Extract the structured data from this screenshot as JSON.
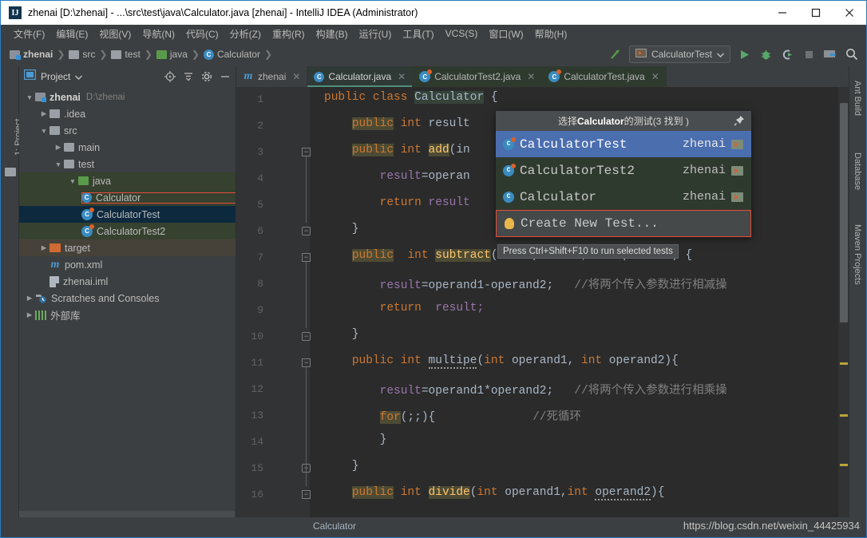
{
  "window": {
    "title": "zhenai [D:\\zhenai] - ...\\src\\test\\java\\Calculator.java [zhenai] - IntelliJ IDEA (Administrator)",
    "app_icon": "IJ",
    "minimize_label": "Minimize",
    "maximize_label": "Maximize",
    "close_label": "Close"
  },
  "menubar": {
    "items": [
      {
        "label": "文件(F)"
      },
      {
        "label": "编辑(E)"
      },
      {
        "label": "视图(V)"
      },
      {
        "label": "导航(N)"
      },
      {
        "label": "代码(C)"
      },
      {
        "label": "分析(Z)"
      },
      {
        "label": "重构(R)"
      },
      {
        "label": "构建(B)"
      },
      {
        "label": "运行(U)"
      },
      {
        "label": "工具(T)"
      },
      {
        "label": "VCS(S)"
      },
      {
        "label": "窗口(W)"
      },
      {
        "label": "帮助(H)"
      }
    ]
  },
  "navbar": {
    "breadcrumbs": [
      {
        "label": "zhenai",
        "icon": "module-icon"
      },
      {
        "label": "src",
        "icon": "folder-icon"
      },
      {
        "label": "test",
        "icon": "folder-icon"
      },
      {
        "label": "java",
        "icon": "source-folder-icon"
      },
      {
        "label": "Calculator",
        "icon": "class-icon"
      }
    ],
    "run_configuration": "CalculatorTest",
    "buttons": [
      {
        "name": "make-project-button",
        "icon": "hammer-arrow-icon"
      },
      {
        "name": "run-button",
        "icon": "play-icon"
      },
      {
        "name": "debug-button",
        "icon": "bug-icon"
      },
      {
        "name": "run-with-coverage-button",
        "icon": "coverage-icon"
      },
      {
        "name": "stop-button",
        "icon": "stop-icon"
      },
      {
        "name": "project-structure-button",
        "icon": "project-structure-icon"
      },
      {
        "name": "search-everywhere-button",
        "icon": "search-icon"
      }
    ]
  },
  "left_tool_strip": {
    "items": [
      {
        "label": "1: Project",
        "name": "tool-window-project"
      }
    ]
  },
  "right_tool_strip": {
    "items": [
      {
        "label": "Ant Build",
        "name": "tool-window-ant-build"
      },
      {
        "label": "Database",
        "name": "tool-window-database"
      },
      {
        "label": "Maven Projects",
        "name": "tool-window-maven-projects"
      }
    ]
  },
  "project_panel": {
    "title": "Project",
    "header_icons": [
      {
        "name": "locate-icon"
      },
      {
        "name": "collapse-all-icon"
      },
      {
        "name": "settings-gear-icon"
      },
      {
        "name": "hide-icon"
      }
    ],
    "tree": [
      {
        "label": "zhenai",
        "path": "D:\\zhenai",
        "depth": 0,
        "arrow": "▼",
        "icon": "module-icon",
        "bold": true,
        "state": "none"
      },
      {
        "label": ".idea",
        "path": "",
        "depth": 1,
        "arrow": "▶",
        "icon": "folder-icon",
        "bold": false,
        "state": "none"
      },
      {
        "label": "src",
        "path": "",
        "depth": 1,
        "arrow": "▼",
        "icon": "folder-icon",
        "bold": false,
        "state": "none"
      },
      {
        "label": "main",
        "path": "",
        "depth": 2,
        "arrow": "▶",
        "icon": "folder-icon",
        "bold": false,
        "state": "none"
      },
      {
        "label": "test",
        "path": "",
        "depth": 2,
        "arrow": "▼",
        "icon": "folder-icon",
        "bold": false,
        "state": "none"
      },
      {
        "label": "java",
        "path": "",
        "depth": 3,
        "arrow": "▼",
        "icon": "source-folder-icon",
        "bold": false,
        "state": "srcgreen"
      },
      {
        "label": "Calculator",
        "path": "",
        "depth": 4,
        "arrow": "",
        "icon": "class-icon",
        "bold": false,
        "state": "srcgreen-outlined"
      },
      {
        "label": "CalculatorTest",
        "path": "",
        "depth": 4,
        "arrow": "",
        "icon": "test-class-icon",
        "bold": false,
        "state": "selected"
      },
      {
        "label": "CalculatorTest2",
        "path": "",
        "depth": 4,
        "arrow": "",
        "icon": "test-class-icon",
        "bold": false,
        "state": "srcgreen"
      },
      {
        "label": "target",
        "path": "",
        "depth": 1,
        "arrow": "▶",
        "icon": "target-folder-icon",
        "bold": false,
        "state": "tan"
      },
      {
        "label": "pom.xml",
        "path": "",
        "depth": 1,
        "arrow": "",
        "icon": "maven-icon",
        "bold": false,
        "state": "none"
      },
      {
        "label": "zhenai.iml",
        "path": "",
        "depth": 1,
        "arrow": "",
        "icon": "iml-icon",
        "bold": false,
        "state": "none"
      },
      {
        "label": "Scratches and Consoles",
        "path": "",
        "depth": 0,
        "arrow": "▶",
        "icon": "scratches-icon",
        "bold": false,
        "state": "none"
      },
      {
        "label": "外部库",
        "path": "",
        "depth": 0,
        "arrow": "▶",
        "icon": "library-icon",
        "bold": false,
        "state": "none"
      }
    ]
  },
  "editor": {
    "tabs": [
      {
        "label": "zhenai",
        "icon": "maven-icon",
        "active": false,
        "highlight": "none"
      },
      {
        "label": "Calculator.java",
        "icon": "class-icon",
        "active": true,
        "highlight": "active"
      },
      {
        "label": "CalculatorTest2.java",
        "icon": "test-class-icon",
        "active": false,
        "highlight": "green"
      },
      {
        "label": "CalculatorTest.java",
        "icon": "test-class-icon",
        "active": false,
        "highlight": "green"
      }
    ],
    "line_numbers": [
      1,
      2,
      3,
      4,
      5,
      6,
      7,
      8,
      9,
      10,
      11,
      12,
      13,
      14,
      15,
      16
    ],
    "code_lines": [
      {
        "n": 1,
        "tokens": [
          {
            "t": "public ",
            "c": "kw"
          },
          {
            "t": "class ",
            "c": "kw"
          },
          {
            "t": "Calculator",
            "c": "hl-ident"
          },
          {
            "t": " {",
            "c": "plain"
          }
        ]
      },
      {
        "n": 2,
        "tokens": [
          {
            "t": "    ",
            "c": "plain"
          },
          {
            "t": "public",
            "c": "kw hl"
          },
          {
            "t": " ",
            "c": "plain"
          },
          {
            "t": "int",
            "c": "kw"
          },
          {
            "t": " result",
            "c": "plain"
          }
        ]
      },
      {
        "n": 3,
        "tokens": [
          {
            "t": "    ",
            "c": "plain"
          },
          {
            "t": "public",
            "c": "kw hl"
          },
          {
            "t": " ",
            "c": "plain"
          },
          {
            "t": "int",
            "c": "kw"
          },
          {
            "t": " ",
            "c": "plain"
          },
          {
            "t": "add",
            "c": "mname hl"
          },
          {
            "t": "(in",
            "c": "plain"
          }
        ]
      },
      {
        "n": 4,
        "tokens": [
          {
            "t": "        result",
            "c": "var"
          },
          {
            "t": "=operan",
            "c": "plain"
          }
        ]
      },
      {
        "n": 5,
        "tokens": [
          {
            "t": "        ",
            "c": "plain"
          },
          {
            "t": "return",
            "c": "kw"
          },
          {
            "t": " result",
            "c": "var"
          }
        ]
      },
      {
        "n": 6,
        "tokens": [
          {
            "t": "    }",
            "c": "plain"
          }
        ]
      },
      {
        "n": 7,
        "tokens": [
          {
            "t": "    ",
            "c": "plain"
          },
          {
            "t": "public",
            "c": "kw hl"
          },
          {
            "t": "  ",
            "c": "plain"
          },
          {
            "t": "int",
            "c": "kw"
          },
          {
            "t": " ",
            "c": "plain"
          },
          {
            "t": "subtract",
            "c": "mname hl"
          },
          {
            "t": "(int operand1,int operand2) {",
            "c": "plain"
          }
        ]
      },
      {
        "n": 8,
        "tokens": [
          {
            "t": "        result",
            "c": "var"
          },
          {
            "t": "=operand1-operand2;",
            "c": "plain"
          },
          {
            "t": "    //将两个传入参数进行相减操",
            "c": "cmt"
          }
        ]
      },
      {
        "n": 9,
        "tokens": [
          {
            "t": "        ",
            "c": "plain"
          },
          {
            "t": "return",
            "c": "kw"
          },
          {
            "t": "  result;",
            "c": "var"
          }
        ]
      },
      {
        "n": 10,
        "tokens": [
          {
            "t": "    }",
            "c": "plain"
          }
        ]
      },
      {
        "n": 11,
        "tokens": [
          {
            "t": "    ",
            "c": "plain"
          },
          {
            "t": "public",
            "c": "kw"
          },
          {
            "t": " ",
            "c": "plain"
          },
          {
            "t": "int",
            "c": "kw"
          },
          {
            "t": " ",
            "c": "plain"
          },
          {
            "t": "multipe",
            "c": "plain typo"
          },
          {
            "t": "(",
            "c": "plain"
          },
          {
            "t": "int",
            "c": "kw"
          },
          {
            "t": " operand1,",
            "c": "plain"
          },
          {
            "t": "int",
            "c": "kw"
          },
          {
            "t": " operand2){",
            "c": "plain"
          }
        ]
      },
      {
        "n": 12,
        "tokens": [
          {
            "t": "        result",
            "c": "var"
          },
          {
            "t": "=operand1*operand2;",
            "c": "plain"
          },
          {
            "t": "    //将两个传入参数进行相乘操",
            "c": "cmt"
          }
        ]
      },
      {
        "n": 13,
        "tokens": [
          {
            "t": "        ",
            "c": "plain"
          },
          {
            "t": "for",
            "c": "kw hl"
          },
          {
            "t": "(;;){",
            "c": "plain"
          },
          {
            "t": "                //死循环",
            "c": "cmt"
          }
        ]
      },
      {
        "n": 14,
        "tokens": [
          {
            "t": "        }",
            "c": "plain"
          }
        ]
      },
      {
        "n": 15,
        "tokens": [
          {
            "t": "    }",
            "c": "plain"
          }
        ]
      },
      {
        "n": 16,
        "tokens": [
          {
            "t": "    ",
            "c": "plain"
          },
          {
            "t": "public",
            "c": "kw hl"
          },
          {
            "t": " ",
            "c": "plain"
          },
          {
            "t": "int",
            "c": "kw"
          },
          {
            "t": " ",
            "c": "plain"
          },
          {
            "t": "divide",
            "c": "mname hl"
          },
          {
            "t": "(",
            "c": "plain"
          },
          {
            "t": "int",
            "c": "kw"
          },
          {
            "t": " operand1,",
            "c": "plain"
          },
          {
            "t": "int",
            "c": "kw"
          },
          {
            "t": " ",
            "c": "plain"
          },
          {
            "t": "operand2",
            "c": "plain typo"
          },
          {
            "t": "){",
            "c": "plain"
          }
        ]
      }
    ]
  },
  "popup": {
    "title_prefix": "选择 ",
    "title_target": "Calculator",
    "title_suffix": " 的测试(3 找到 )",
    "pin_icon": "pin-icon",
    "items": [
      {
        "name": "CalculatorTest",
        "module": "zhenai",
        "icon": "test-class-icon",
        "selected": true
      },
      {
        "name": "CalculatorTest2",
        "module": "zhenai",
        "icon": "test-class-icon",
        "selected": false
      },
      {
        "name": "Calculator",
        "module": "zhenai",
        "icon": "class-icon",
        "selected": false
      }
    ],
    "create_new": "Create New Test...",
    "tooltip": "Press Ctrl+Shift+F10 to run selected tests"
  },
  "status_bar": {
    "breadcrumb": "Calculator",
    "watermark": "https://blog.csdn.net/weixin_44425934"
  }
}
